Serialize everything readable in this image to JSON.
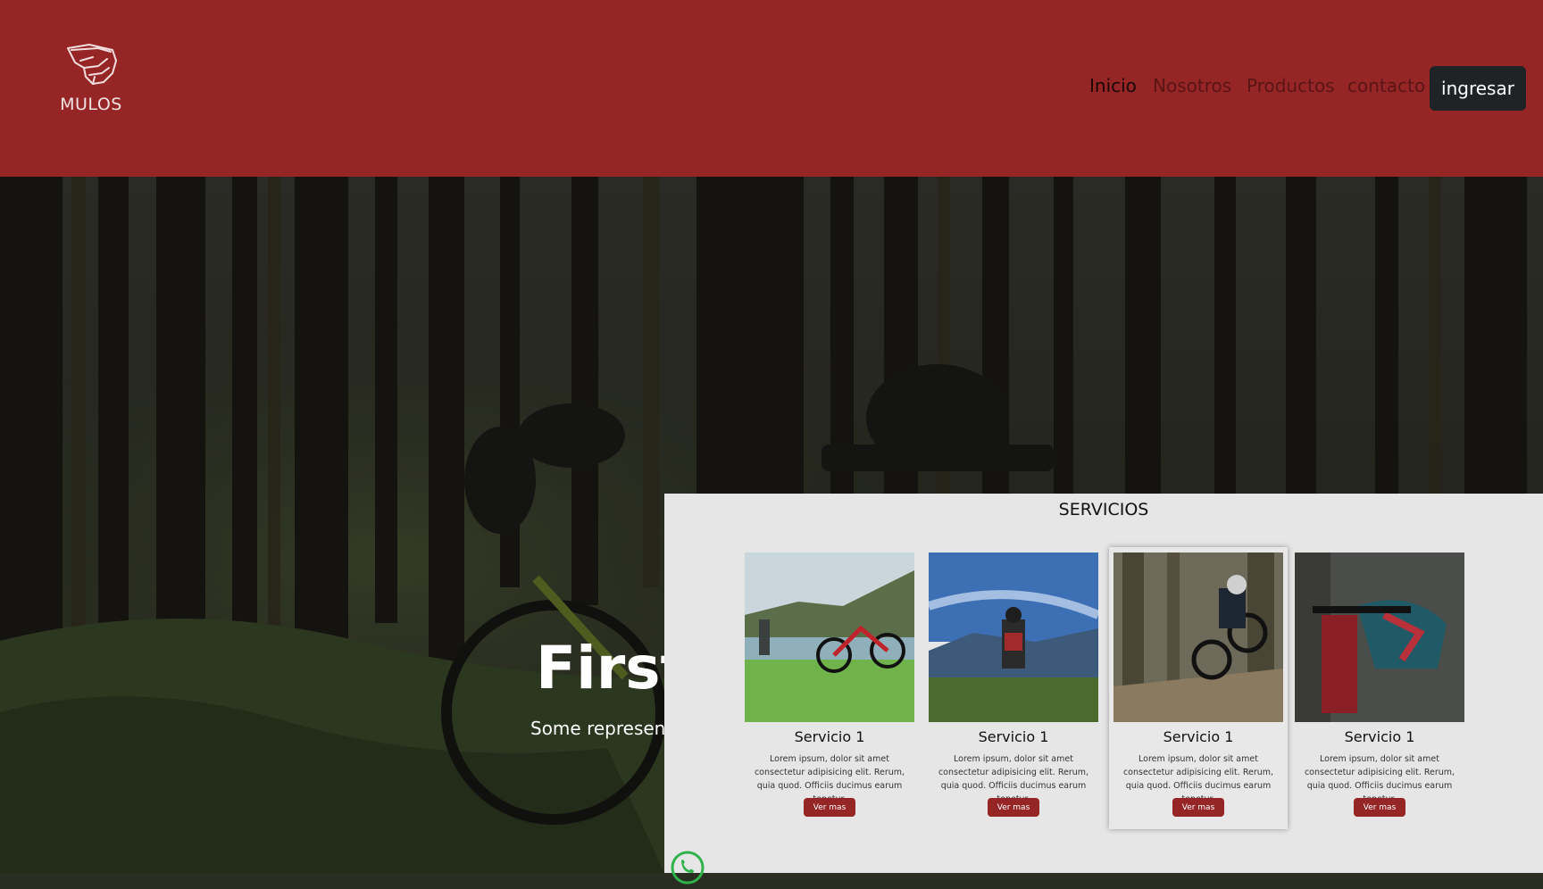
{
  "header": {
    "logo_text": "MULOS",
    "logo_icon": "helmet-icon",
    "nav": [
      {
        "label": "Inicio",
        "active": true
      },
      {
        "label": "Nosotros",
        "active": false
      },
      {
        "label": "Productos",
        "active": false
      },
      {
        "label": "contacto",
        "active": false
      }
    ],
    "login_label": "ingresar"
  },
  "hero": {
    "title": "First slide label",
    "caption": "Some representative placeholder content for the first slide."
  },
  "services": {
    "title": "SERVICIOS",
    "cards": [
      {
        "title": "Servicio 1",
        "text": "Lorem ipsum, dolor sit amet consectetur adipisicing elit. Rerum, quia quod. Officiis ducimus earum tenetur.",
        "button": "Ver mas"
      },
      {
        "title": "Servicio 1",
        "text": "Lorem ipsum, dolor sit amet consectetur adipisicing elit. Rerum, quia quod. Officiis ducimus earum tenetur.",
        "button": "Ver mas"
      },
      {
        "title": "Servicio 1",
        "text": "Lorem ipsum, dolor sit amet consectetur adipisicing elit. Rerum, quia quod. Officiis ducimus earum tenetur.",
        "button": "Ver mas"
      },
      {
        "title": "Servicio 1",
        "text": "Lorem ipsum, dolor sit amet consectetur adipisicing elit. Rerum, quia quod. Officiis ducimus earum tenetur.",
        "button": "Ver mas"
      }
    ]
  },
  "floating": {
    "whatsapp_icon": "whatsapp-icon"
  },
  "colors": {
    "brand": "#962526",
    "dark_button": "#1f2326",
    "panel": "#e6e6e6"
  }
}
